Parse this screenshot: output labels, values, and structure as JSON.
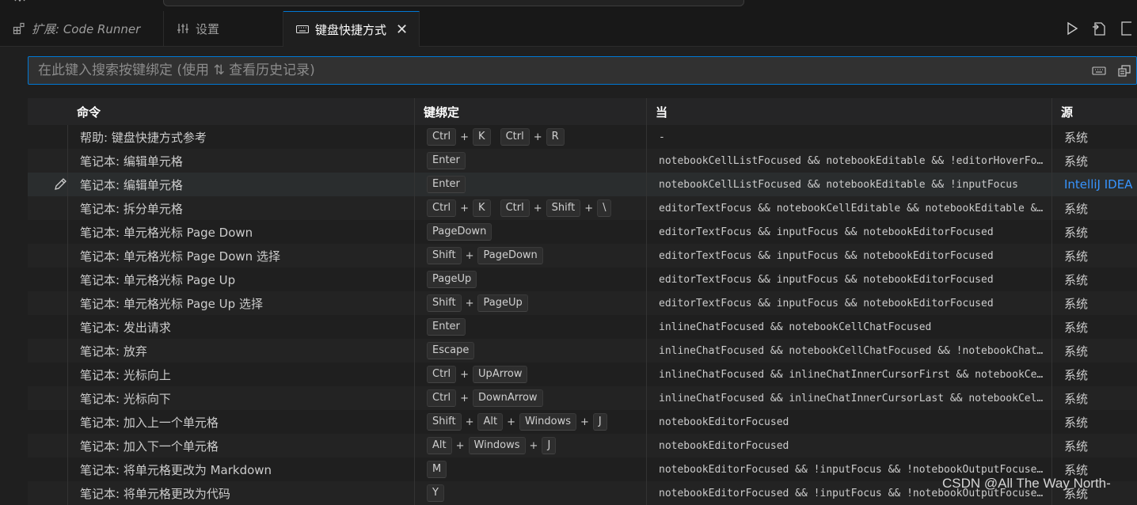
{
  "tabs": [
    {
      "label": "扩展: Code Runner",
      "icon": "extensions-icon"
    },
    {
      "label": "设置",
      "icon": "settings-sliders-icon"
    },
    {
      "label": "键盘快捷方式",
      "icon": "keyboard-icon",
      "active": true
    }
  ],
  "tab_actions": [
    "run-icon",
    "open-json-icon",
    "split-editor-icon"
  ],
  "search": {
    "placeholder": "在此键入搜索按键绑定 (使用 ⇅ 查看历史记录)",
    "value": ""
  },
  "columns": {
    "command": "命令",
    "keybinding": "键绑定",
    "when": "当",
    "source": "源"
  },
  "rows": [
    {
      "command": "帮助: 键盘快捷方式参考",
      "keys": [
        [
          "Ctrl",
          "K"
        ],
        [
          "Ctrl",
          "R"
        ]
      ],
      "when": "-",
      "source": "系统"
    },
    {
      "command": "笔记本: 编辑单元格",
      "keys": [
        [
          "Enter"
        ]
      ],
      "when": "notebookCellListFocused && notebookEditable && !editorHoverFo…",
      "source": "系统"
    },
    {
      "command": "笔记本: 编辑单元格",
      "keys": [
        [
          "Enter"
        ]
      ],
      "when": "notebookCellListFocused && notebookEditable && !inputFocus",
      "source": "IntelliJ IDEA K",
      "source_link": true,
      "editable": true
    },
    {
      "command": "笔记本: 拆分单元格",
      "keys": [
        [
          "Ctrl",
          "K"
        ],
        [
          "Ctrl",
          "Shift",
          "\\"
        ]
      ],
      "when": "editorTextFocus && notebookCellEditable && notebookEditable &…",
      "source": "系统"
    },
    {
      "command": "笔记本: 单元格光标 Page Down",
      "keys": [
        [
          "PageDown"
        ]
      ],
      "when": "editorTextFocus && inputFocus && notebookEditorFocused",
      "source": "系统"
    },
    {
      "command": "笔记本: 单元格光标 Page Down 选择",
      "keys": [
        [
          "Shift",
          "PageDown"
        ]
      ],
      "when": "editorTextFocus && inputFocus && notebookEditorFocused",
      "source": "系统"
    },
    {
      "command": "笔记本: 单元格光标 Page Up",
      "keys": [
        [
          "PageUp"
        ]
      ],
      "when": "editorTextFocus && inputFocus && notebookEditorFocused",
      "source": "系统"
    },
    {
      "command": "笔记本: 单元格光标 Page Up 选择",
      "keys": [
        [
          "Shift",
          "PageUp"
        ]
      ],
      "when": "editorTextFocus && inputFocus && notebookEditorFocused",
      "source": "系统"
    },
    {
      "command": "笔记本: 发出请求",
      "keys": [
        [
          "Enter"
        ]
      ],
      "when": "inlineChatFocused && notebookCellChatFocused",
      "source": "系统"
    },
    {
      "command": "笔记本: 放弃",
      "keys": [
        [
          "Escape"
        ]
      ],
      "when": "inlineChatFocused && notebookCellChatFocused && !notebookChat…",
      "source": "系统"
    },
    {
      "command": "笔记本: 光标向上",
      "keys": [
        [
          "Ctrl",
          "UpArrow"
        ]
      ],
      "when": "inlineChatFocused && inlineChatInnerCursorFirst && notebookCe…",
      "source": "系统"
    },
    {
      "command": "笔记本: 光标向下",
      "keys": [
        [
          "Ctrl",
          "DownArrow"
        ]
      ],
      "when": "inlineChatFocused && inlineChatInnerCursorLast && notebookCel…",
      "source": "系统"
    },
    {
      "command": "笔记本: 加入上一个单元格",
      "keys": [
        [
          "Shift",
          "Alt",
          "Windows",
          "J"
        ]
      ],
      "when": "notebookEditorFocused",
      "source": "系统"
    },
    {
      "command": "笔记本: 加入下一个单元格",
      "keys": [
        [
          "Alt",
          "Windows",
          "J"
        ]
      ],
      "when": "notebookEditorFocused",
      "source": "系统"
    },
    {
      "command": "笔记本: 将单元格更改为 Markdown",
      "keys": [
        [
          "M"
        ]
      ],
      "when": "notebookEditorFocused && !inputFocus && !notebookOutputFocuse…",
      "source": "系统"
    },
    {
      "command": "笔记本: 将单元格更改为代码",
      "keys": [
        [
          "Y"
        ]
      ],
      "when": "notebookEditorFocused && !inputFocus && !notebookOutputFocuse…",
      "source": "系统"
    }
  ],
  "watermark": "CSDN @All The Way North-",
  "colors": {
    "accent": "#0078d4",
    "link": "#3794ff",
    "background": "#1f1f1f"
  }
}
